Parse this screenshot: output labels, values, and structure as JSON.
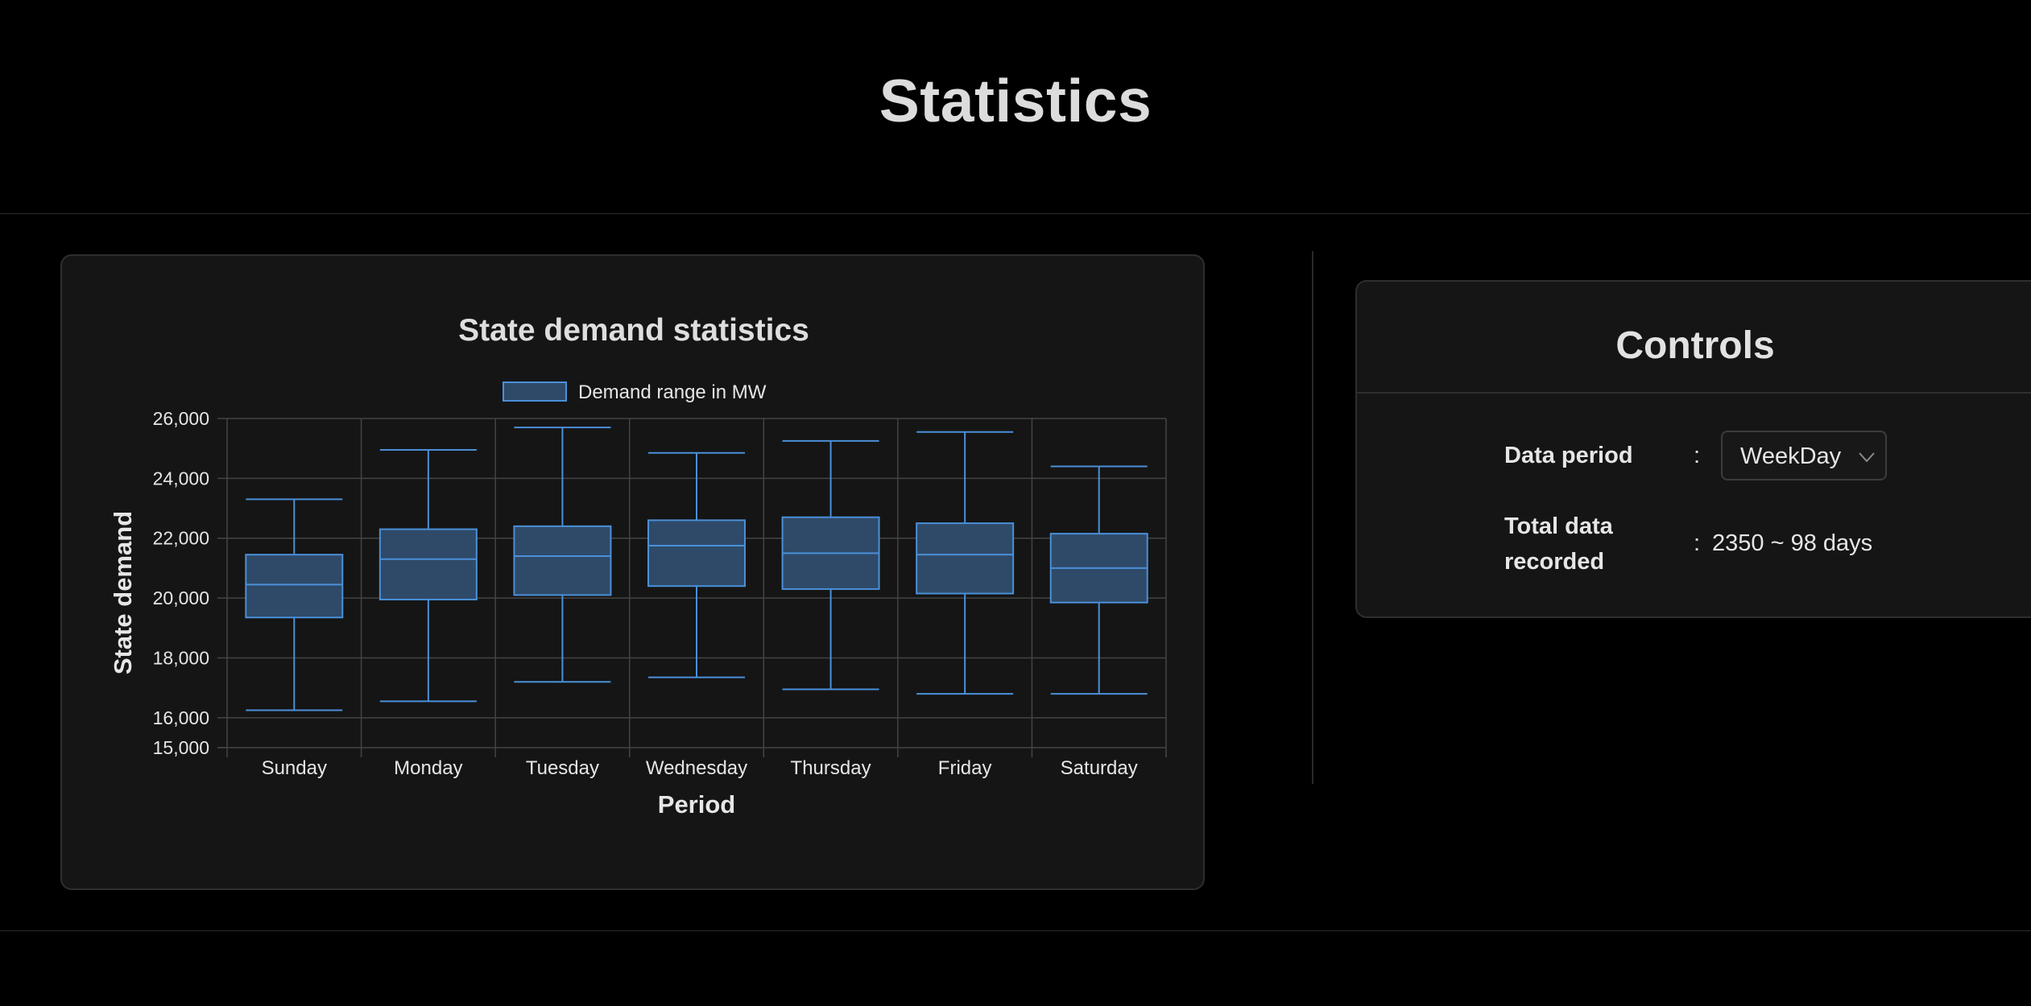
{
  "page": {
    "title": "Statistics"
  },
  "chart_data": {
    "type": "boxplot",
    "title": "State demand statistics",
    "legend": {
      "label": "Demand range in MW",
      "position": "top-center"
    },
    "xlabel": "Period",
    "ylabel": "State demand",
    "ylim": [
      15000,
      26000
    ],
    "yticks": [
      "26,000",
      "24,000",
      "22,000",
      "20,000",
      "18,000",
      "16,000",
      "15,000"
    ],
    "grid": true,
    "categories": [
      "Sunday",
      "Monday",
      "Tuesday",
      "Wednesday",
      "Thursday",
      "Friday",
      "Saturday"
    ],
    "series": [
      {
        "name": "Demand range in MW",
        "boxes": [
          {
            "min": 16250,
            "q1": 19350,
            "median": 20450,
            "q3": 21450,
            "max": 23300
          },
          {
            "min": 16550,
            "q1": 19950,
            "median": 21300,
            "q3": 22300,
            "max": 24950
          },
          {
            "min": 17200,
            "q1": 20100,
            "median": 21400,
            "q3": 22400,
            "max": 25700
          },
          {
            "min": 17350,
            "q1": 20400,
            "median": 21750,
            "q3": 22600,
            "max": 24850
          },
          {
            "min": 16950,
            "q1": 20300,
            "median": 21500,
            "q3": 22700,
            "max": 25250
          },
          {
            "min": 16800,
            "q1": 20150,
            "median": 21450,
            "q3": 22500,
            "max": 25550
          },
          {
            "min": 16800,
            "q1": 19850,
            "median": 21000,
            "q3": 22150,
            "max": 24400
          }
        ]
      }
    ],
    "colors": {
      "box_fill": "#2f4a68",
      "box_stroke": "#4a90d9",
      "grid": "#444444",
      "text": "#e6e6e6"
    }
  },
  "controls": {
    "title": "Controls",
    "data_period_label": "Data period",
    "colon": ":",
    "data_period_value": "WeekDay",
    "total_label": "Total data recorded",
    "total_value": "2350 ~ 98 days",
    "chevron_icon": "chevron-down-icon"
  }
}
